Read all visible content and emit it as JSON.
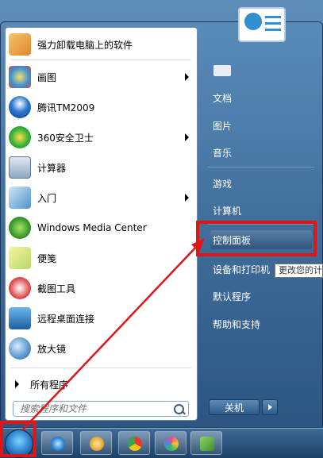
{
  "programs": [
    {
      "label": "强力卸载电脑上的软件",
      "icon": "uninstall-icon",
      "has_arrow": false
    },
    {
      "label": "画图",
      "icon": "paint-icon",
      "has_arrow": true
    },
    {
      "label": "腾讯TM2009",
      "icon": "tm-icon",
      "has_arrow": false
    },
    {
      "label": "360安全卫士",
      "icon": "360-icon",
      "has_arrow": true
    },
    {
      "label": "计算器",
      "icon": "calculator-icon",
      "has_arrow": false
    },
    {
      "label": "入门",
      "icon": "getting-started-icon",
      "has_arrow": true
    },
    {
      "label": "Windows Media Center",
      "icon": "media-center-icon",
      "has_arrow": false
    },
    {
      "label": "便笺",
      "icon": "sticky-notes-icon",
      "has_arrow": false
    },
    {
      "label": "截图工具",
      "icon": "snipping-tool-icon",
      "has_arrow": false
    },
    {
      "label": "远程桌面连接",
      "icon": "remote-desktop-icon",
      "has_arrow": false
    },
    {
      "label": "放大镜",
      "icon": "magnifier-icon",
      "has_arrow": false
    }
  ],
  "all_programs": "所有程序",
  "search_placeholder": "搜索程序和文件",
  "right_items": [
    "文档",
    "图片",
    "音乐",
    "游戏",
    "计算机",
    "控制面板",
    "设备和打印机",
    "默认程序",
    "帮助和支持"
  ],
  "tooltip": "更改您的计",
  "shutdown": "关机",
  "colors": {
    "highlight": "#e01515"
  }
}
